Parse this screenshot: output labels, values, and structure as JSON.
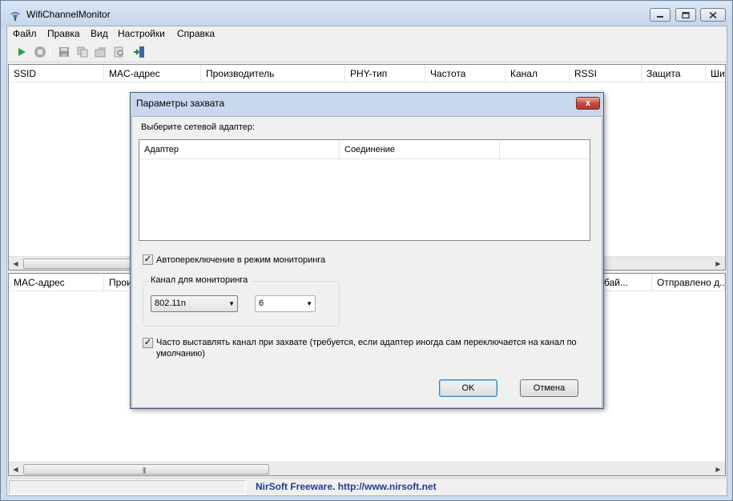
{
  "window": {
    "title": "WifiChannelMonitor"
  },
  "menu": [
    "Файл",
    "Правка",
    "Вид",
    "Настройки",
    "Справка"
  ],
  "toolbar": [
    "play-icon",
    "stop-icon",
    "save-icon",
    "copy-icon",
    "properties-icon",
    "find-icon",
    "exit-icon"
  ],
  "top_list": {
    "columns": [
      "SSID",
      "MAC-адрес",
      "Производитель",
      "PHY-тип",
      "Частота",
      "Канал",
      "RSSI",
      "Защита",
      "Шиф"
    ]
  },
  "bottom_list": {
    "columns": [
      "MAC-адрес",
      "Прои",
      "о бай...",
      "Отправлено д..."
    ]
  },
  "status": {
    "link_text": "NirSoft Freeware.  http://www.nirsoft.net"
  },
  "dialog": {
    "title": "Параметры захвата",
    "close": "x",
    "select_adapter_label": "Выберите сетевой адаптер:",
    "adapter_columns": [
      "Адаптер",
      "Соединение"
    ],
    "auto_monitor": {
      "label": "Автопереключение в режим мониторинга",
      "checked": true
    },
    "channel_group": {
      "title": "Канал для мониторинга",
      "mode_value": "802.11n",
      "channel_value": "6"
    },
    "frequent_set": {
      "label": "Часто выставлять канал при захвате (требуется, если адаптер иногда сам переключается на канал по умолчанию)",
      "checked": true
    },
    "ok_label": "OK",
    "cancel_label": "Отмена"
  }
}
